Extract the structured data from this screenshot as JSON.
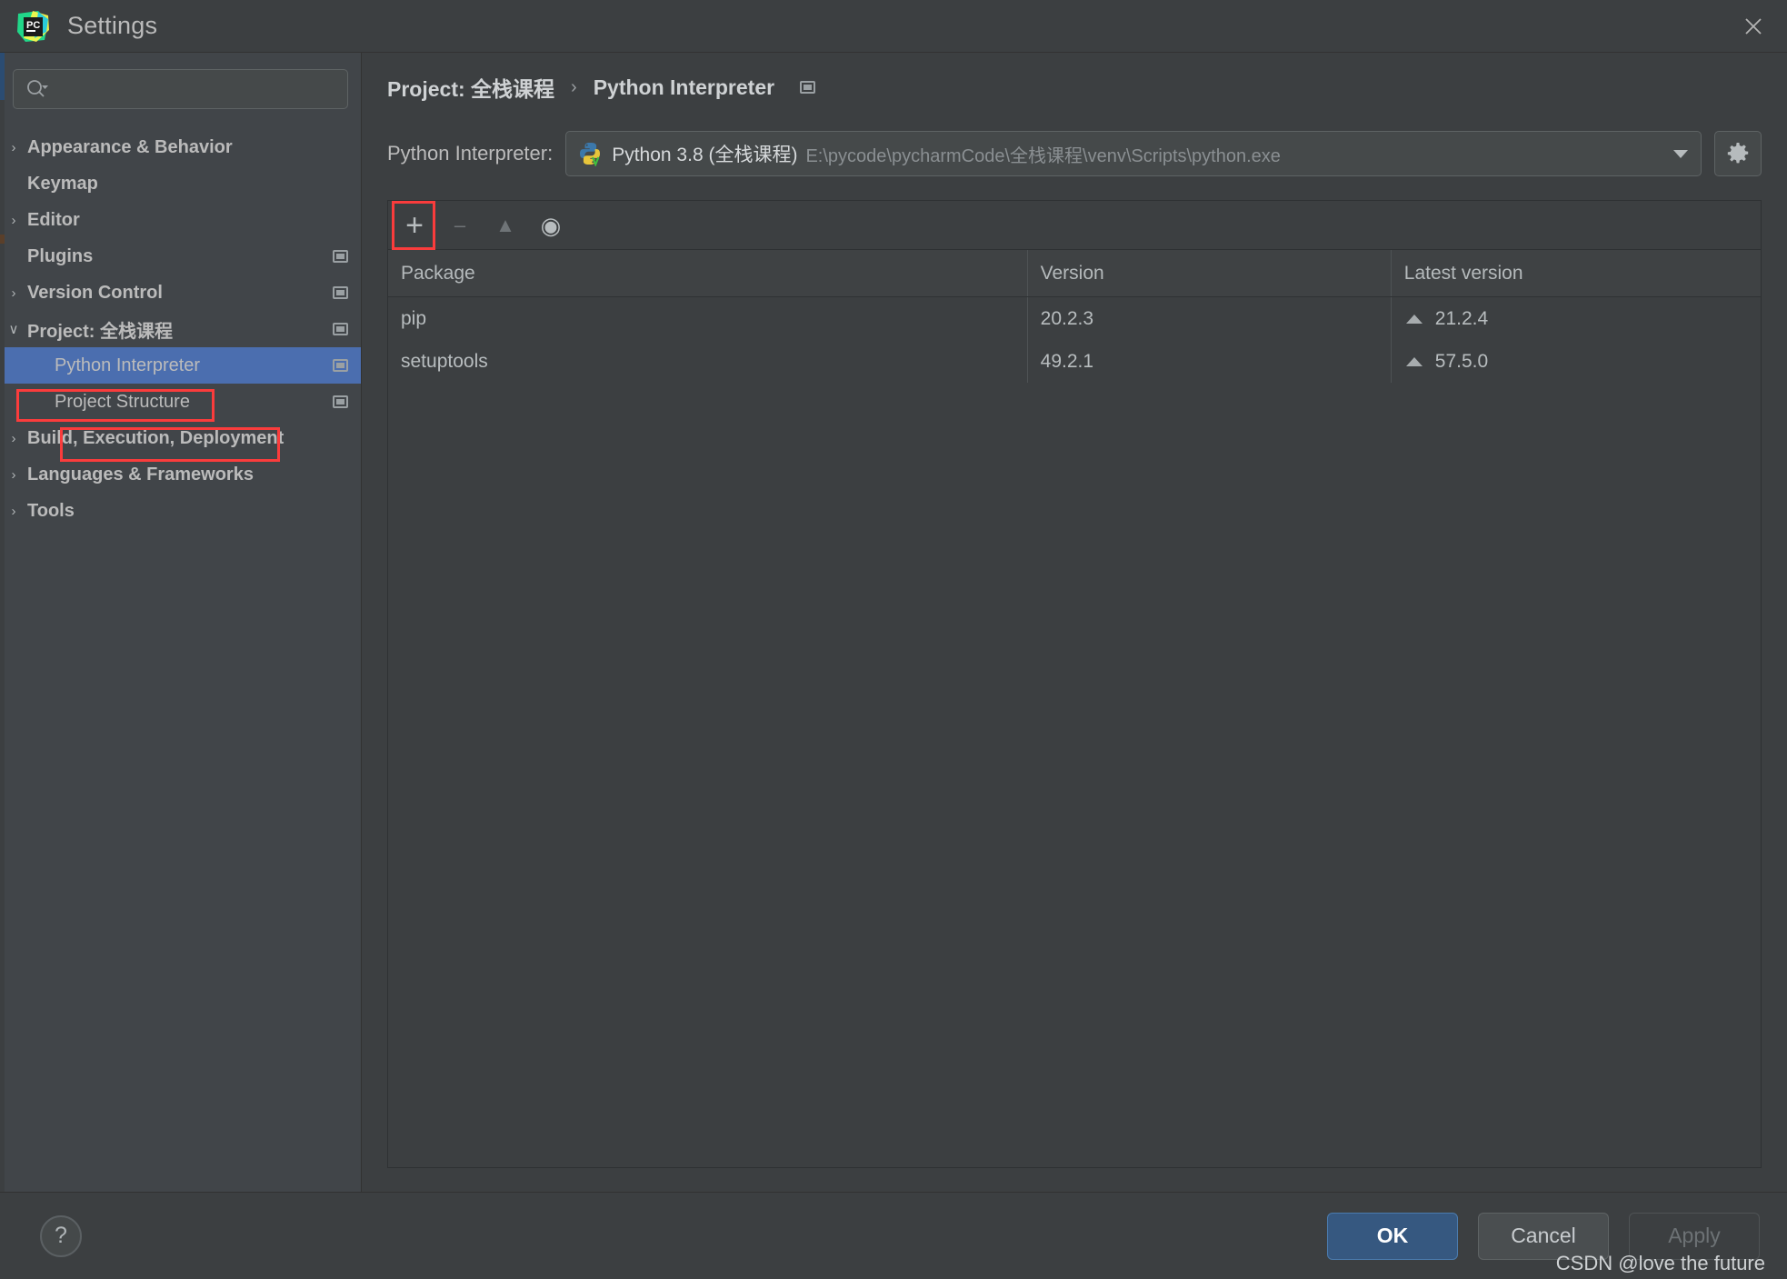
{
  "window": {
    "title": "Settings",
    "logo_icon": "pycharm-logo-icon",
    "close_icon": "close-icon"
  },
  "sidebar": {
    "search": {
      "placeholder": "",
      "value": "",
      "icon": "search-icon"
    },
    "items": [
      {
        "label": "Appearance & Behavior",
        "chevron": "›",
        "indent": 0,
        "bold": true,
        "badge": false,
        "selected": false
      },
      {
        "label": "Keymap",
        "chevron": "",
        "indent": 0,
        "bold": true,
        "badge": false,
        "selected": false
      },
      {
        "label": "Editor",
        "chevron": "›",
        "indent": 0,
        "bold": true,
        "badge": false,
        "selected": false
      },
      {
        "label": "Plugins",
        "chevron": "",
        "indent": 0,
        "bold": true,
        "badge": true,
        "selected": false
      },
      {
        "label": "Version Control",
        "chevron": "›",
        "indent": 0,
        "bold": true,
        "badge": true,
        "selected": false
      },
      {
        "label": "Project: 全栈课程",
        "chevron": "∨",
        "indent": 0,
        "bold": true,
        "badge": true,
        "selected": false
      },
      {
        "label": "Python Interpreter",
        "chevron": "",
        "indent": 1,
        "bold": false,
        "badge": true,
        "selected": true
      },
      {
        "label": "Project Structure",
        "chevron": "",
        "indent": 1,
        "bold": false,
        "badge": true,
        "selected": false
      },
      {
        "label": "Build, Execution, Deployment",
        "chevron": "›",
        "indent": 0,
        "bold": true,
        "badge": false,
        "selected": false
      },
      {
        "label": "Languages & Frameworks",
        "chevron": "›",
        "indent": 0,
        "bold": true,
        "badge": false,
        "selected": false
      },
      {
        "label": "Tools",
        "chevron": "›",
        "indent": 0,
        "bold": true,
        "badge": false,
        "selected": false
      }
    ]
  },
  "main": {
    "breadcrumb": {
      "root": "Project: 全栈课程",
      "separator": "›",
      "current": "Python Interpreter",
      "badge_icon": "project-badge-icon"
    },
    "interpreter": {
      "label": "Python Interpreter:",
      "icon": "python-venv-icon",
      "name": "Python 3.8 (全栈课程)",
      "path": "E:\\pycode\\pycharmCode\\全栈课程\\venv\\Scripts\\python.exe",
      "dropdown_icon": "chevron-down-icon",
      "settings_icon": "gear-icon"
    },
    "packages": {
      "toolbar": [
        {
          "name": "add-package-button",
          "icon": "plus-icon",
          "glyph": "+",
          "enabled": true
        },
        {
          "name": "remove-package-button",
          "icon": "minus-icon",
          "glyph": "–",
          "enabled": false
        },
        {
          "name": "upgrade-package-button",
          "icon": "up-arrow-icon",
          "glyph": "▲",
          "enabled": false
        },
        {
          "name": "show-early-releases-button",
          "icon": "eye-icon",
          "glyph": "◉",
          "enabled": true
        }
      ],
      "columns": [
        "Package",
        "Version",
        "Latest version"
      ],
      "rows": [
        {
          "package": "pip",
          "version": "20.2.3",
          "latest": "21.2.4",
          "upgradable": true
        },
        {
          "package": "setuptools",
          "version": "49.2.1",
          "latest": "57.5.0",
          "upgradable": true
        }
      ]
    }
  },
  "footer": {
    "help_label": "?",
    "ok_label": "OK",
    "cancel_label": "Cancel",
    "apply_label": "Apply",
    "watermark": "CSDN @love the future"
  },
  "colors": {
    "accent_selection": "#4b6eaf",
    "primary_button": "#365880",
    "annotation": "#fa3c3c",
    "background": "#3c3f41",
    "sidebar": "#414549"
  }
}
